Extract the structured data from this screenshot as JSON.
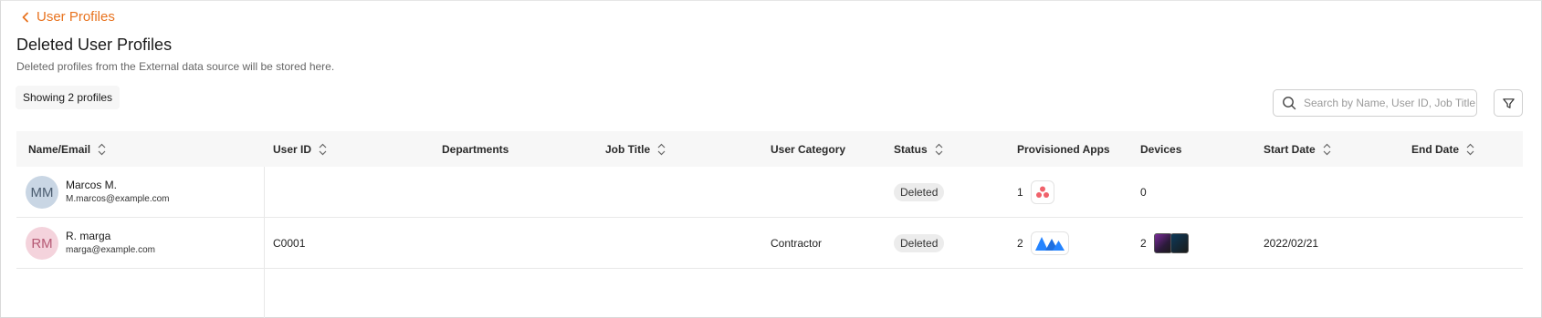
{
  "header": {
    "back_label": "User Profiles",
    "title": "Deleted User Profiles",
    "subtitle": "Deleted profiles from the External data source will be stored here.",
    "count_label": "Showing 2 profiles"
  },
  "search": {
    "placeholder": "Search by Name, User ID, Job Title..."
  },
  "table": {
    "columns": {
      "name": "Name/Email",
      "user_id": "User ID",
      "departments": "Departments",
      "job_title": "Job Title",
      "category": "User Category",
      "status": "Status",
      "apps": "Provisioned Apps",
      "devices": "Devices",
      "start_date": "Start Date",
      "end_date": "End Date"
    },
    "rows": [
      {
        "initials": "MM",
        "name": "Marcos M.",
        "email": "M.marcos@example.com",
        "user_id": "",
        "departments": "",
        "job_title": "",
        "category": "",
        "status": "Deleted",
        "apps_count": "1",
        "devices_count": "0",
        "start_date": "",
        "end_date": ""
      },
      {
        "initials": "RM",
        "name": "R. marga",
        "email": "marga@example.com",
        "user_id": "C0001",
        "departments": "",
        "job_title": "",
        "category": "Contractor",
        "status": "Deleted",
        "apps_count": "2",
        "devices_count": "2",
        "start_date": "2022/02/21",
        "end_date": ""
      }
    ]
  },
  "colors": {
    "accent": "#e8731f",
    "avatar_mm": "#c9d6e4",
    "avatar_rm": "#f4d3dc"
  },
  "icons": [
    "chevron-left-icon",
    "search-icon",
    "filter-icon",
    "sort-icon",
    "asana-icon",
    "atlassian-icon",
    "device-icon"
  ]
}
